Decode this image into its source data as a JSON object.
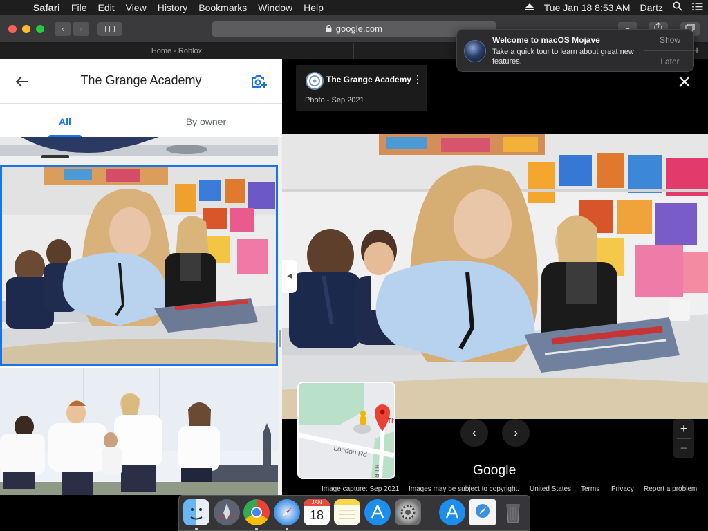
{
  "menubar": {
    "apple_glyph": "",
    "app_name": "Safari",
    "menus": [
      "File",
      "Edit",
      "View",
      "History",
      "Bookmarks",
      "Window",
      "Help"
    ],
    "clock": "Tue Jan 18  8:53 AM",
    "user": "Dartz"
  },
  "toolbar": {
    "url": "google.com",
    "back_glyph": "‹",
    "forward_glyph": "›"
  },
  "tabs": {
    "active_tab_title": "Home - Roblox"
  },
  "notification": {
    "title": "Welcome to macOS Mojave",
    "body": "Take a quick tour to learn about great new features.",
    "show_label": "Show",
    "later_label": "Later"
  },
  "left_panel": {
    "title": "The Grange Academy",
    "tabs": [
      {
        "label": "All",
        "active": true
      },
      {
        "label": "By owner",
        "active": false
      }
    ],
    "accent_color": "#1a73e8"
  },
  "viewer": {
    "place_name": "The Grange Academy",
    "photo_meta": "Photo - Sep 2021",
    "prev_glyph": "‹",
    "next_glyph": "›",
    "zoom_in": "+",
    "zoom_out": "−",
    "brand": "Google",
    "minimap_road_label": "London Rd",
    "minimap_side_road": "Hill Rd",
    "minimap_poi_partial": "Th"
  },
  "footer": {
    "image_capture": "Image capture: Sep 2021",
    "copyright": "Images may be subject to copyright.",
    "region": "United States",
    "terms": "Terms",
    "privacy": "Privacy",
    "report": "Report a problem"
  },
  "dock": {
    "icons": [
      "finder-icon",
      "launchpad-icon",
      "chrome-icon",
      "safari-icon",
      "calendar-icon",
      "notes-icon",
      "app-store-icon",
      "system-preferences-icon",
      "app-store-icon",
      "downloads-stack-icon",
      "trash-icon"
    ],
    "calendar_month": "JAN",
    "calendar_day": "18"
  }
}
